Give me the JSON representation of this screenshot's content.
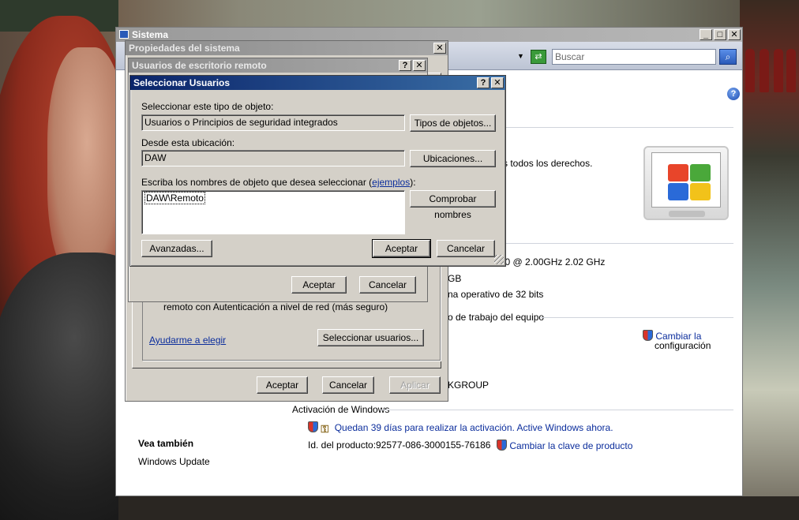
{
  "sistema": {
    "title": "Sistema",
    "search_placeholder": "Buscar",
    "rights_text": "s todos los derechos.",
    "cpu_text": "uo CPU     T5750  @ 2.00GHz   2.02 GHz",
    "ram_text": "GB",
    "systype_text": "na operativo de 32 bits",
    "section_workgroup": "o de trabajo del equipo",
    "change_config_line1": "Cambiar la",
    "change_config_line2": "configuración",
    "workgroup_value": "KGROUP",
    "section_activation": "Activación de Windows",
    "activation_text": "Quedan 39 días para realizar la activación. Active Windows ahora.",
    "product_id_label": "Id. del producto:",
    "product_id_value": "92577-086-3000155-76186",
    "change_key_link": "Cambiar la clave de producto",
    "see_also_heading": "Vea también",
    "windows_update_link": "Windows Update"
  },
  "propiedades": {
    "title": "Propiedades del sistema",
    "nla_text": "remoto con Autenticación a nivel de red (más seguro)",
    "help_link": "Ayudarme a elegir",
    "select_users_button": "Seleccionar usuarios...",
    "ok_button": "Aceptar",
    "cancel_button": "Cancelar",
    "apply_button": "Aplicar"
  },
  "usuarios": {
    "title": "Usuarios de escritorio remoto",
    "ok_button": "Aceptar",
    "cancel_button": "Cancelar"
  },
  "seleccionar": {
    "title": "Seleccionar Usuarios",
    "object_type_label": "Seleccionar este tipo de objeto:",
    "object_type_value": "Usuarios o Principios de seguridad integrados",
    "object_types_button": "Tipos de objetos...",
    "location_label": "Desde esta ubicación:",
    "location_value": "DAW",
    "locations_button": "Ubicaciones...",
    "names_label_prefix": "Escriba los nombres de objeto que desea seleccionar (",
    "names_label_link": "ejemplos",
    "names_label_suffix": "):",
    "names_value": "DAW\\Remoto",
    "check_names_button": "Comprobar nombres",
    "advanced_button": "Avanzadas...",
    "ok_button": "Aceptar",
    "cancel_button": "Cancelar"
  },
  "colors": {
    "active_title_start": "#0a246a",
    "active_title_end": "#3a6ea5",
    "inactive_title": "#a8a8a8",
    "dialog_face": "#d4d0c8",
    "link": "#0b2d9c"
  }
}
